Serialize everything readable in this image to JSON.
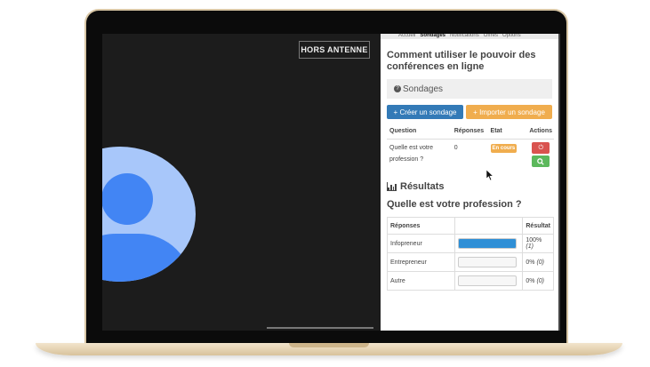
{
  "colors": {
    "primary_blue": "#337ab7",
    "orange": "#f0ad4e",
    "red": "#d9534f",
    "green": "#5cb85c",
    "avatar_light": "#a8c7fa",
    "avatar_dark": "#4285f4"
  },
  "video": {
    "on_air_label": "HORS ANTENNE"
  },
  "nav": {
    "tabs": [
      "Accueil",
      "Sondages",
      "Notifications",
      "Offres",
      "Options"
    ]
  },
  "panel": {
    "title": "Comment utiliser le pouvoir des conférences en ligne",
    "section_label": "Sondages",
    "create_button": "Créer un sondage",
    "import_button": "Importer un sondage"
  },
  "polls_table": {
    "headers": [
      "Question",
      "Réponses",
      "Etat",
      "Actions"
    ],
    "rows": [
      {
        "question": "Quelle est votre profession ?",
        "responses": "0",
        "status": "En cours"
      }
    ]
  },
  "results": {
    "heading": "Résultats",
    "question": "Quelle est votre profession ?",
    "headers": [
      "Réponses",
      "",
      "Résultat"
    ],
    "rows": [
      {
        "label": "Infopreneur",
        "fraction": 1.0,
        "percent": "100%",
        "count": "(1)"
      },
      {
        "label": "Entrepreneur",
        "fraction": 0.0,
        "percent": "0%",
        "count": "(0)"
      },
      {
        "label": "Autre",
        "fraction": 0.0,
        "percent": "0%",
        "count": "(0)"
      }
    ]
  },
  "icons": {
    "power": "power-icon",
    "search": "search-icon",
    "question": "question-circle-icon",
    "chart": "bar-chart-icon",
    "plus": "plus-icon"
  }
}
